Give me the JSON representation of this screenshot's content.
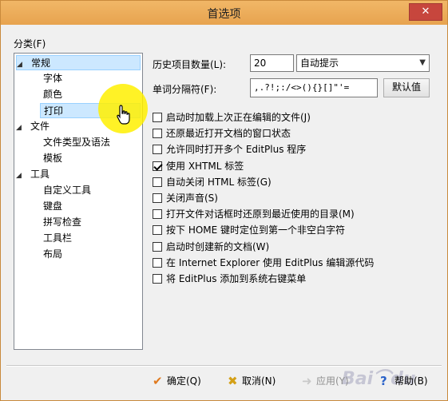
{
  "window": {
    "title": "首选项",
    "close_glyph": "✕"
  },
  "category_label": "分类(F)",
  "tree": [
    {
      "label": "常规",
      "expanded": true,
      "level": 0,
      "selected": true
    },
    {
      "label": "字体",
      "level": 1
    },
    {
      "label": "颜色",
      "level": 1
    },
    {
      "label": "打印",
      "level": 1,
      "hover": true
    },
    {
      "label": "文件",
      "expanded": true,
      "level": 0
    },
    {
      "label": "文件类型及语法",
      "level": 1
    },
    {
      "label": "模板",
      "level": 1
    },
    {
      "label": "工具",
      "expanded": true,
      "level": 0
    },
    {
      "label": "自定义工具",
      "level": 1
    },
    {
      "label": "键盘",
      "level": 1
    },
    {
      "label": "拼写检查",
      "level": 1
    },
    {
      "label": "工具栏",
      "level": 1
    },
    {
      "label": "布局",
      "level": 1
    }
  ],
  "history": {
    "label": "历史项目数量(L):",
    "value": "20",
    "mode_selected": "自动提示"
  },
  "delimiter": {
    "label": "单词分隔符(F):",
    "value": ",.?!;:/<>(){}[]\"'=",
    "default_button": "默认值"
  },
  "options": [
    {
      "label": "启动时加载上次正在编辑的文件(J)",
      "checked": false
    },
    {
      "label": "还原最近打开文档的窗口状态",
      "checked": false
    },
    {
      "label": "允许同时打开多个 EditPlus 程序",
      "checked": false
    },
    {
      "label": "使用 XHTML 标签",
      "checked": true
    },
    {
      "label": "自动关闭 HTML 标签(G)",
      "checked": false
    },
    {
      "label": "关闭声音(S)",
      "checked": false
    },
    {
      "label": "打开文件对话框时还原到最近使用的目录(M)",
      "checked": false
    },
    {
      "label": "按下 HOME 键时定位到第一个非空白字符",
      "checked": false
    },
    {
      "label": "启动时创建新的文档(W)",
      "checked": false
    },
    {
      "label": "在 Internet Explorer 使用 EditPlus 编辑源代码",
      "checked": false
    },
    {
      "label": "将 EditPlus 添加到系统右键菜单",
      "checked": false
    }
  ],
  "buttons": {
    "ok": "确定(Q)",
    "cancel": "取消(N)",
    "apply": "应用(Y)",
    "help": "帮助(B)"
  },
  "colors": {
    "titlebar": "#e7a34f",
    "selection": "#cce8ff",
    "ok_icon": "#e07a1f",
    "cancel_icon": "#d4a017",
    "help_icon": "#2a62c9"
  }
}
